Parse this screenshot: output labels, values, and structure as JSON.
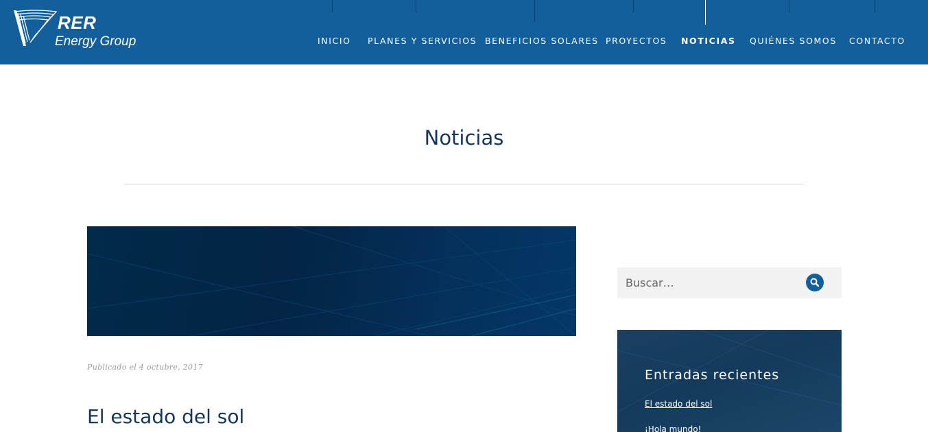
{
  "brand": {
    "name": "RER",
    "subtitle": "Energy Group"
  },
  "nav": {
    "items": [
      {
        "label": "INICIO",
        "active": false
      },
      {
        "label": "PLANES Y SERVICIOS",
        "active": false
      },
      {
        "label": "BENEFICIOS SOLARES",
        "active": false
      },
      {
        "label": "PROYECTOS",
        "active": false
      },
      {
        "label": "NOTICIAS",
        "active": true
      },
      {
        "label": "QUIÉNES SOMOS",
        "active": false
      },
      {
        "label": "CONTACTO",
        "active": false
      }
    ]
  },
  "page": {
    "title": "Noticias"
  },
  "post": {
    "meta": "Publicado el 4 octubre, 2017",
    "title": "El estado del sol"
  },
  "sidebar": {
    "search": {
      "placeholder": "Buscar…",
      "icon": "search-icon"
    },
    "recent": {
      "title": "Entradas recientes",
      "items": [
        "El estado del sol",
        "¡Hola mundo!"
      ]
    }
  },
  "colors": {
    "header_bg": "#135f9b",
    "title_text": "#15365a",
    "sidebar_widget_bg": "#143a5c"
  }
}
